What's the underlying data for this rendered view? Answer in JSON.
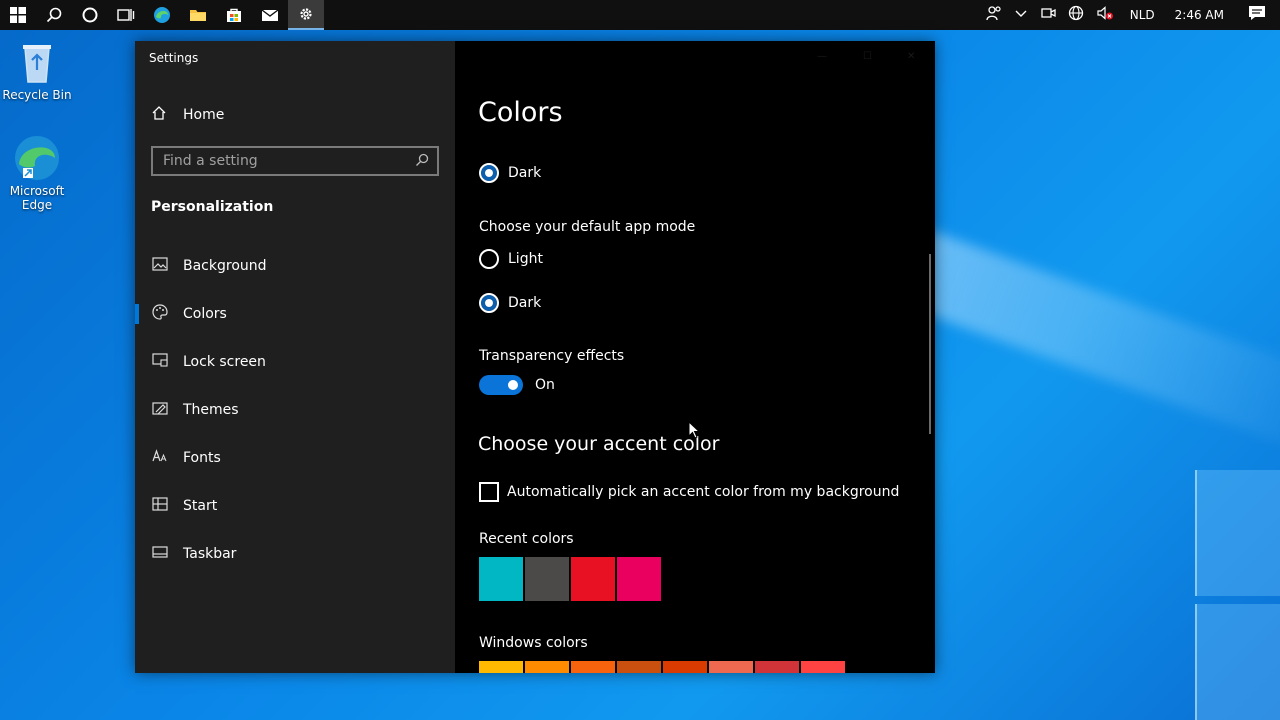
{
  "taskbar": {
    "tray_language": "NLD",
    "tray_time": "2:46 AM"
  },
  "desktop": {
    "icons": [
      {
        "label": "Recycle Bin"
      },
      {
        "label": "Microsoft Edge"
      }
    ]
  },
  "window": {
    "title": "Settings"
  },
  "sidebar": {
    "home": "Home",
    "search_placeholder": "Find a setting",
    "section": "Personalization",
    "items": [
      {
        "label": "Background",
        "icon": "image-icon"
      },
      {
        "label": "Colors",
        "icon": "palette-icon"
      },
      {
        "label": "Lock screen",
        "icon": "lock-screen-icon"
      },
      {
        "label": "Themes",
        "icon": "themes-icon"
      },
      {
        "label": "Fonts",
        "icon": "fonts-icon"
      },
      {
        "label": "Start",
        "icon": "start-icon"
      },
      {
        "label": "Taskbar",
        "icon": "taskbar-icon"
      }
    ]
  },
  "content": {
    "title": "Colors",
    "windows_mode_dark": "Dark",
    "app_mode_label": "Choose your default app mode",
    "app_mode_light": "Light",
    "app_mode_dark": "Dark",
    "transparency_label": "Transparency effects",
    "transparency_state": "On",
    "accent_title": "Choose your accent color",
    "auto_accent_label": "Automatically pick an accent color from my background",
    "recent_label": "Recent colors",
    "recent_colors": [
      "#00b7c3",
      "#4c4a48",
      "#e81123",
      "#ea005e"
    ],
    "windows_label": "Windows colors",
    "windows_colors": [
      "#ffb900",
      "#ff8c00",
      "#f7630c",
      "#ca5010",
      "#da3b01",
      "#ef6950",
      "#d13438",
      "#ff4343"
    ]
  }
}
